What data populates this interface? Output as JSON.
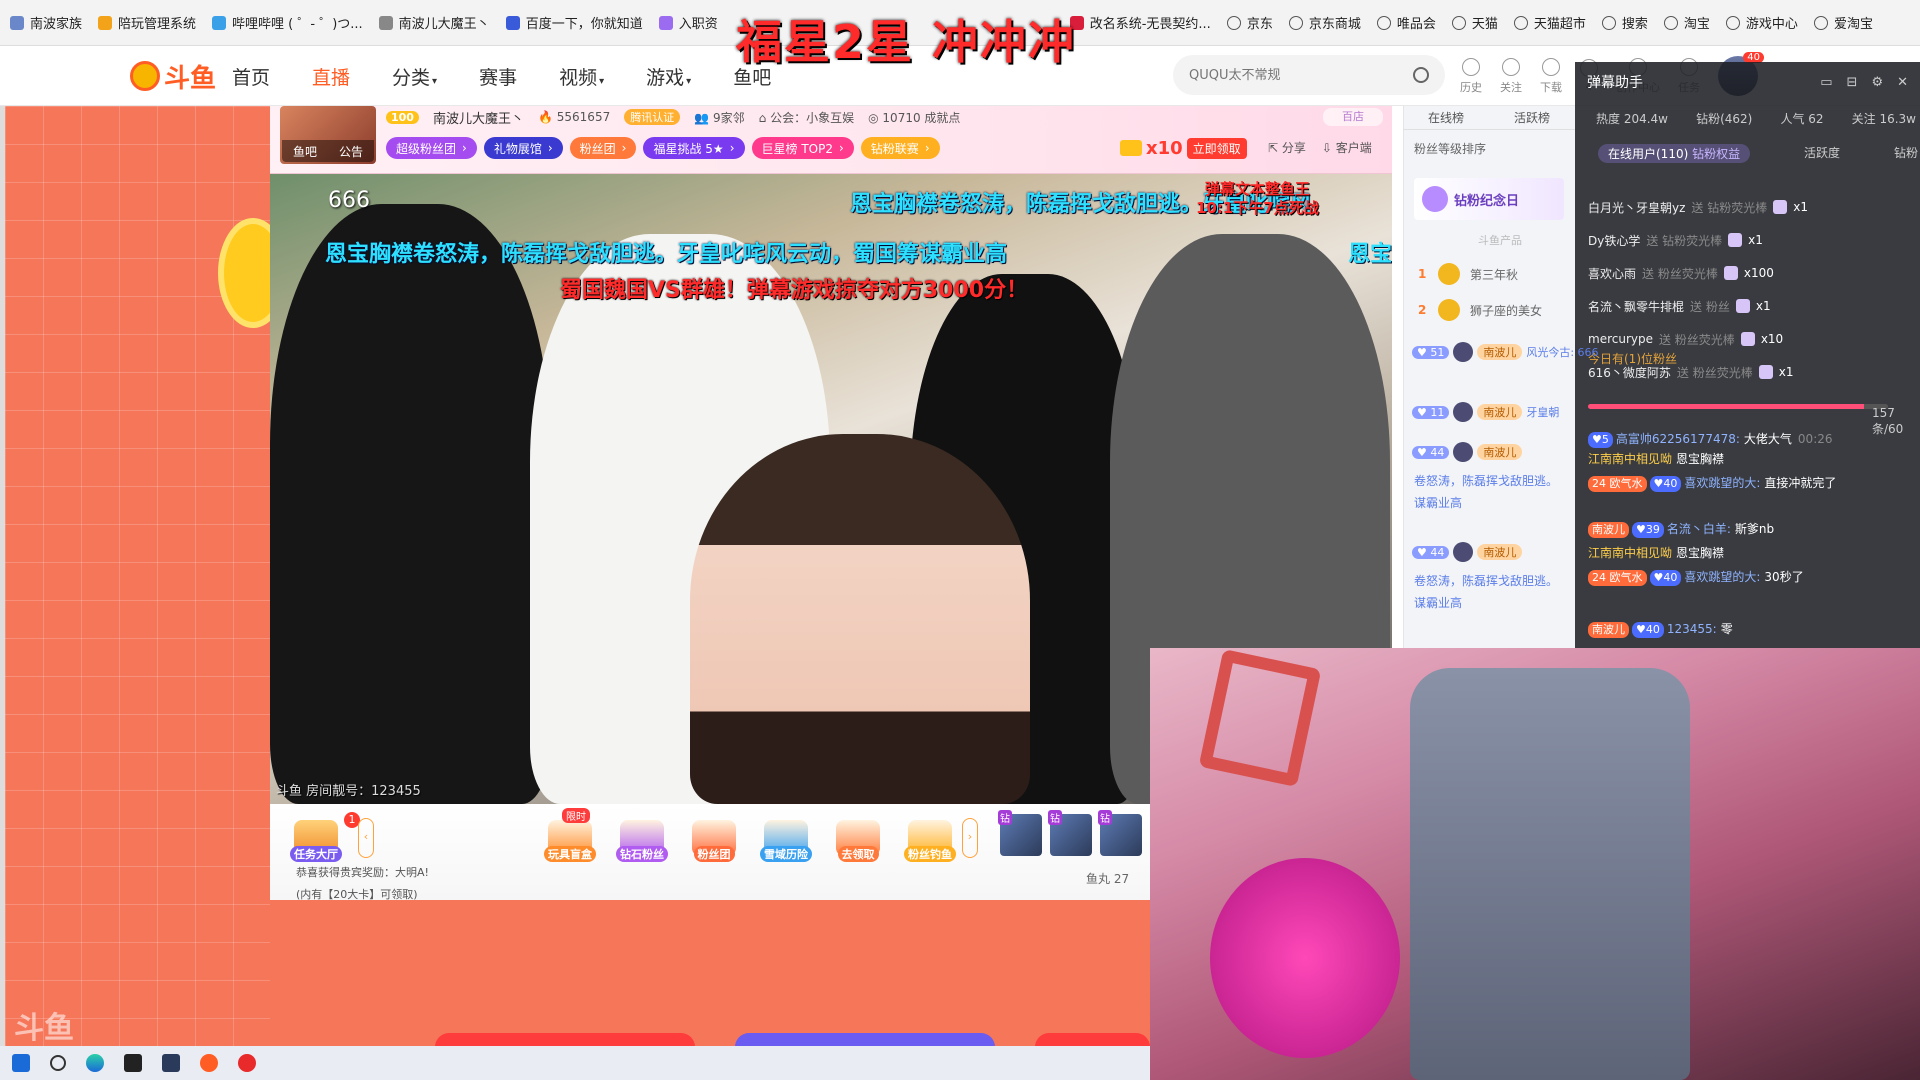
{
  "bookmarks": [
    {
      "label": "南波家族",
      "icon": "person-icon",
      "color": "#6a88c9"
    },
    {
      "label": "陪玩管理系统",
      "icon": "cat-icon",
      "color": "#f2a31a"
    },
    {
      "label": "哔哩哔哩 ( ゜- ゜)つ...",
      "icon": "bilibili-icon",
      "color": "#3aa0e8"
    },
    {
      "label": "南波儿大魔王丶",
      "icon": "fish-icon",
      "color": "#888888"
    },
    {
      "label": "百度一下，你就知道",
      "icon": "baidu-icon",
      "color": "#3a5bd9"
    },
    {
      "label": "入职资",
      "icon": "diamond-icon",
      "color": "#9b6cf0"
    },
    {
      "label": "改名系统-无畏契约...",
      "icon": "valorant-icon",
      "color": "#d81e3a"
    },
    {
      "label": "京东",
      "icon": "globe-icon",
      "color": ""
    },
    {
      "label": "京东商城",
      "icon": "globe-icon",
      "color": ""
    },
    {
      "label": "唯品会",
      "icon": "globe-icon",
      "color": ""
    },
    {
      "label": "天猫",
      "icon": "globe-icon",
      "color": ""
    },
    {
      "label": "天猫超市",
      "icon": "globe-icon",
      "color": ""
    },
    {
      "label": "搜索",
      "icon": "globe-icon",
      "color": ""
    },
    {
      "label": "淘宝",
      "icon": "globe-icon",
      "color": ""
    },
    {
      "label": "游戏中心",
      "icon": "globe-icon",
      "color": ""
    },
    {
      "label": "爱淘宝",
      "icon": "globe-icon",
      "color": ""
    }
  ],
  "overlay_title": "福星2星 冲冲冲",
  "nav": {
    "logo_text": "斗鱼",
    "logo_sub": "DOUYU.COM",
    "links": [
      "首页",
      "直播",
      "分类",
      "赛事",
      "视频",
      "游戏",
      "鱼吧"
    ],
    "active_link": "直播",
    "search_placeholder": "QUQU太不常规",
    "icons": [
      {
        "label": "历史"
      },
      {
        "label": "关注"
      },
      {
        "label": "下载"
      },
      {
        "label": "4"
      },
      {
        "label": "创作中心"
      },
      {
        "label": "任务"
      }
    ],
    "avatar_badge": "40"
  },
  "room": {
    "avatar_tag_left": "鱼吧",
    "avatar_tag_right": "公告",
    "level": "100",
    "streamer": "南波儿大魔王丶",
    "hot": "5561657",
    "cert": "腾讯认证",
    "family": "9家邻",
    "guild": "公会：小象互娱",
    "achievements": "10710 成就点",
    "chips": [
      {
        "label": "超级粉丝团",
        "color": "#a54cf0"
      },
      {
        "label": "礼物展馆",
        "color": "#3a3ad0"
      },
      {
        "label": "粉丝团",
        "color": "#ff7a3a"
      },
      {
        "label": "福星挑战 5★",
        "color": "#7a3af0"
      },
      {
        "label": "巨星榜 TOP2",
        "color": "#ff3a8c"
      },
      {
        "label": "钻粉联赛",
        "color": "#ffb020"
      }
    ],
    "multiplier": "x10",
    "claim_btn": "立即领取",
    "share": "分享",
    "client": "客户端",
    "hundred_label": "百店"
  },
  "video": {
    "count_label": "666",
    "danmaku_1": "恩宝胸襟卷怒涛，陈磊挥戈敌胆逃。牙皇叱咤风",
    "danmaku_1b_l1": "弹幕文本整鱼王",
    "danmaku_1b_l2": "10:1下午7点死战",
    "danmaku_2": "恩宝胸襟卷怒涛，陈磊挥戈敌胆逃。牙皇叱咤风云动，蜀国筹谋霸业高",
    "danmaku_2b": "恩宝",
    "danmaku_3": "蜀国魏国VS群雄！弹幕游戏掠夺对方3000分！",
    "room_no": "斗鱼 房间靓号：123455"
  },
  "toolbar": {
    "task_hall": "任务大厅",
    "task_badge": "1",
    "limited_tag": "限时",
    "items": [
      {
        "label": "玩具盲盒",
        "color": "#ff8c2b"
      },
      {
        "label": "钻石粉丝",
        "color": "#b05cf0"
      },
      {
        "label": "粉丝团",
        "color": "#ff6b3a"
      },
      {
        "label": "雪域历险",
        "color": "#3aa0f0"
      },
      {
        "label": "去领取",
        "color": "#ff7a3a"
      },
      {
        "label": "粉丝钓鱼",
        "color": "#ffb020"
      }
    ],
    "thumb_tag": "钻",
    "notice_1": "恭喜获得贵宾奖励：大明A!",
    "notice_2": "(内有【20大卡】可领取)",
    "yuwan": "鱼丸 27"
  },
  "side": {
    "tabs": [
      "在线榜",
      "活跃榜"
    ],
    "sort_label": "粉丝等级排序",
    "memo": "钻粉纪念日",
    "memo_hint": "斗鱼产品",
    "ranks": [
      {
        "n": "1",
        "name": "第三年秋"
      },
      {
        "n": "2",
        "name": "狮子座的美女"
      }
    ],
    "badges": [
      {
        "lv": "51",
        "nm": "南波儿",
        "text": "风光今古: 666"
      },
      {
        "lv": "11",
        "nm": "南波儿",
        "text": "牙皇朝"
      },
      {
        "lv": "44",
        "nm": "南波儿",
        "text": ""
      },
      {
        "lv": "44",
        "nm": "南波儿",
        "text": ""
      }
    ],
    "chat_1": "卷怒涛，陈磊挥戈敌胆逃。",
    "chat_1b": "谋霸业高",
    "chat_2": "卷怒涛，陈磊挥戈敌胆逃。",
    "chat_2b": "谋霸业高"
  },
  "chat": {
    "title": "弹幕助手",
    "hot": "热度 204.4w",
    "diamond": "钻粉(462)",
    "popularity": "人气 62",
    "follow": "关注 16.3w",
    "online": "在线用户(110)",
    "rights": "钻粉权益",
    "active": "活跃度",
    "diamond_short": "钻粉",
    "gifts": [
      {
        "name": "白月光丶牙皇朝yz",
        "sent": "送 钻粉荧光棒",
        "count": "x1"
      },
      {
        "name": "Dy铁心学",
        "sent": "送 钻粉荧光棒",
        "count": "x1"
      },
      {
        "name": "喜欢心雨",
        "sent": "送 粉丝荧光棒",
        "count": "x100"
      },
      {
        "name": "名流丶飘零牛排棍",
        "sent": "送 粉丝",
        "count": "x1"
      },
      {
        "name": "mercurype",
        "sent": "送 粉丝荧光棒",
        "count": "x10"
      },
      {
        "name": "616丶微度阿苏",
        "sent": "送 粉丝荧光棒",
        "count": "x1"
      }
    ],
    "ad_gift": "今日有(1)位粉丝",
    "progress": 0.92,
    "progress_text": "157条/60",
    "messages": [
      {
        "lv": "5",
        "user": "高富帅62256177478:",
        "text": "大佬大气",
        "time": "00:26"
      },
      {
        "user2": "江南南中相见呦",
        "text": "恩宝胸襟"
      },
      {
        "badge": "24 欧气水",
        "lv": "40",
        "user": "喜欢跳望的大:",
        "text": "直接冲就完了"
      },
      {
        "badge": "南波儿",
        "lv": "39",
        "user": "名流丶白羊:",
        "text": "斯爹nb"
      },
      {
        "user2": "江南南中相见呦",
        "text": "恩宝胸襟"
      },
      {
        "badge": "24 欧气水",
        "lv": "40",
        "user": "喜欢跳望的大:",
        "text": "30秒了"
      },
      {
        "badge": "南波儿",
        "lv": "40",
        "user": "123455:",
        "text": "零"
      }
    ]
  },
  "watermark": "斗鱼",
  "colors": {
    "brand": "#ff5d23",
    "danmaku_cyan": "#2de0ff",
    "danmaku_red": "#ff2a2a",
    "chat_bg": "#1e2026"
  }
}
